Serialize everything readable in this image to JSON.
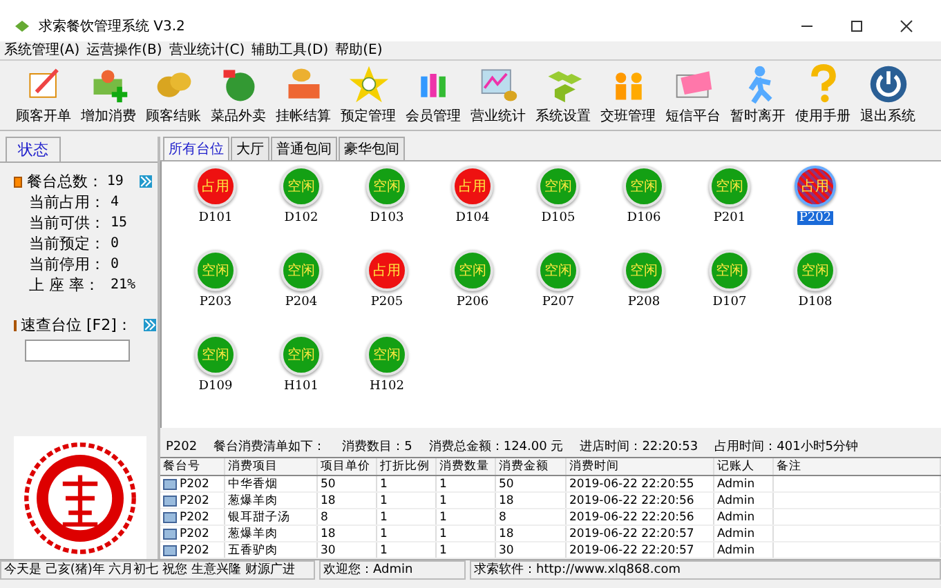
{
  "window": {
    "title": "求索餐饮管理系统 V3.2"
  },
  "menu": [
    "系统管理(A)",
    "运营操作(B)",
    "营业统计(C)",
    "辅助工具(D)",
    "帮助(E)"
  ],
  "toolbar": [
    "顾客开单",
    "增加消费",
    "顾客结账",
    "菜品外卖",
    "挂帐结算",
    "预定管理",
    "会员管理",
    "营业统计",
    "系统设置",
    "交班管理",
    "短信平台",
    "暂时离开",
    "使用手册",
    "退出系统"
  ],
  "side_tabs": [
    {
      "label": "状态",
      "selected": true
    }
  ],
  "stats_title": {
    "label": "餐台总数：",
    "value": "19"
  },
  "stats": [
    {
      "label": "当前占用：",
      "value": "4"
    },
    {
      "label": "当前可供：",
      "value": "15"
    },
    {
      "label": "当前预定：",
      "value": "0"
    },
    {
      "label": "当前停用：",
      "value": "0"
    },
    {
      "label": "上 座 率：",
      "value": "21%"
    }
  ],
  "quick_search": {
    "label": "速查台位 [F2]："
  },
  "area_tabs": [
    {
      "label": "所有台位",
      "selected": true
    },
    {
      "label": "大厅",
      "selected": false
    },
    {
      "label": "普通包间",
      "selected": false
    },
    {
      "label": "豪华包间",
      "selected": false
    }
  ],
  "tables": [
    {
      "name": "D101",
      "occupied": true,
      "badge": "占用",
      "selected": false
    },
    {
      "name": "D102",
      "occupied": false,
      "badge": "空闲",
      "selected": false
    },
    {
      "name": "D103",
      "occupied": false,
      "badge": "空闲",
      "selected": false
    },
    {
      "name": "D104",
      "occupied": true,
      "badge": "占用",
      "selected": false
    },
    {
      "name": "D105",
      "occupied": false,
      "badge": "空闲",
      "selected": false
    },
    {
      "name": "D106",
      "occupied": false,
      "badge": "空闲",
      "selected": false
    },
    {
      "name": "P201",
      "occupied": false,
      "badge": "空闲",
      "selected": false
    },
    {
      "name": "P202",
      "occupied": true,
      "badge": "占用",
      "selected": true
    },
    {
      "name": "P203",
      "occupied": false,
      "badge": "空闲",
      "selected": false
    },
    {
      "name": "P204",
      "occupied": false,
      "badge": "空闲",
      "selected": false
    },
    {
      "name": "P205",
      "occupied": true,
      "badge": "占用",
      "selected": false
    },
    {
      "name": "P206",
      "occupied": false,
      "badge": "空闲",
      "selected": false
    },
    {
      "name": "P207",
      "occupied": false,
      "badge": "空闲",
      "selected": false
    },
    {
      "name": "P208",
      "occupied": false,
      "badge": "空闲",
      "selected": false
    },
    {
      "name": "D107",
      "occupied": false,
      "badge": "空闲",
      "selected": false
    },
    {
      "name": "D108",
      "occupied": false,
      "badge": "空闲",
      "selected": false
    },
    {
      "name": "D109",
      "occupied": false,
      "badge": "空闲",
      "selected": false
    },
    {
      "name": "H101",
      "occupied": false,
      "badge": "空闲",
      "selected": false
    },
    {
      "name": "H102",
      "occupied": false,
      "badge": "空闲",
      "selected": false
    }
  ],
  "order_info": [
    "P202",
    "餐台消费清单如下：",
    "消费数目：5",
    "消费总金额：124.00 元",
    "进店时间：22:20:53",
    "占用时间：401小时5分钟"
  ],
  "order_table": {
    "columns": [
      "餐台号",
      "消费项目",
      "项目单价",
      "打折比例",
      "消费数量",
      "消费金额",
      "消费时间",
      "记账人",
      "备注"
    ],
    "rows": [
      [
        "P202",
        "中华香烟",
        "50",
        "1",
        "1",
        "50",
        "2019-06-22 22:20:55",
        "Admin"
      ],
      [
        "P202",
        "葱爆羊肉",
        "18",
        "1",
        "1",
        "18",
        "2019-06-22 22:20:56",
        "Admin"
      ],
      [
        "P202",
        "银耳甜子汤",
        "8",
        "1",
        "1",
        "8",
        "2019-06-22 22:20:56",
        "Admin"
      ],
      [
        "P202",
        "葱爆羊肉",
        "18",
        "1",
        "1",
        "18",
        "2019-06-22 22:20:57",
        "Admin"
      ],
      [
        "P202",
        "五香驴肉",
        "30",
        "1",
        "1",
        "30",
        "2019-06-22 22:20:57",
        "Admin"
      ]
    ]
  },
  "status_bar": [
    "今天是 己亥(猪)年 六月初七 祝您 生意兴隆 财源广进",
    "欢迎您：Admin",
    "求索软件：http://www.xlq868.com"
  ]
}
